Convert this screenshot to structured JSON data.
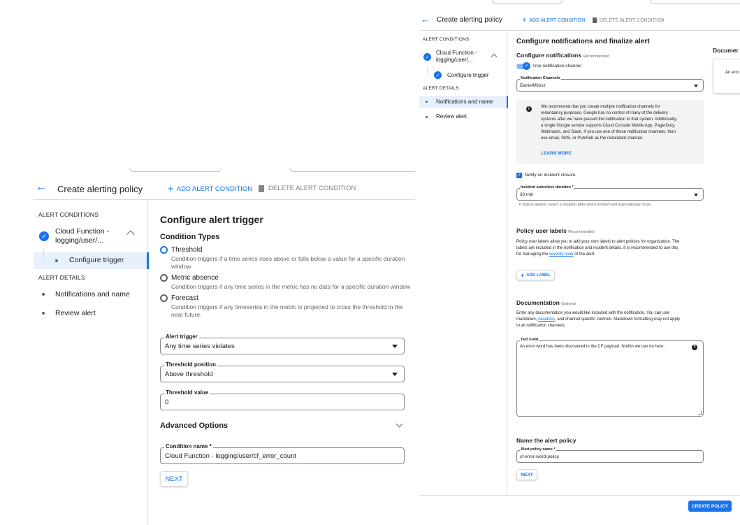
{
  "left": {
    "header": {
      "title": "Create alerting policy",
      "add_condition": "ADD ALERT CONDITION",
      "delete_condition": "DELETE ALERT CONDITION"
    },
    "sidebar": {
      "alert_conditions_label": "ALERT CONDITIONS",
      "condition_name_line1": "Cloud Function -",
      "condition_name_line2": "logging/user/...",
      "configure_trigger": "Configure trigger",
      "alert_details_label": "ALERT DETAILS",
      "notifications_and_name": "Notifications and name",
      "review_alert": "Review alert"
    },
    "main": {
      "title": "Configure alert trigger",
      "condition_types_heading": "Condition Types",
      "options": [
        {
          "label": "Threshold",
          "desc_line1": "Condition triggers if a time series rises above or falls below a value for a specific duration",
          "desc_line2": "window",
          "selected": true
        },
        {
          "label": "Metric absence",
          "desc_line1": "Condition triggers if any time series in the metric has no data for a specific duration window",
          "desc_line2": "",
          "selected": false
        },
        {
          "label": "Forecast",
          "desc_line1": "Condition triggers if any timeseries in the metric is projected to cross the threshold in the",
          "desc_line2": "near future.",
          "selected": false
        }
      ],
      "alert_trigger": {
        "label": "Alert trigger",
        "value": "Any time series violates"
      },
      "threshold_position": {
        "label": "Threshold position",
        "value": "Above threshold"
      },
      "threshold_value": {
        "label": "Threshold value",
        "value": "0"
      },
      "advanced_options": "Advanced Options",
      "condition_name": {
        "label": "Condition name *",
        "value": "Cloud Function - logging/user/cf_error_count"
      },
      "next": "NEXT"
    }
  },
  "right": {
    "header": {
      "title": "Create alerting policy",
      "add_condition": "ADD ALERT CONDITION",
      "delete_condition": "DELETE ALERT CONDITION"
    },
    "sidebar": {
      "alert_conditions_label": "ALERT CONDITIONS",
      "condition_name_line1": "Cloud Function -",
      "condition_name_line2": "logging/user/...",
      "configure_trigger": "Configure trigger",
      "alert_details_label": "ALERT DETAILS",
      "notifications_and_name": "Notifications and name",
      "review_alert": "Review alert"
    },
    "main": {
      "title": "Configure notifications and finalize alert",
      "configure_notifications": "Configure notifications",
      "recommended": "Recommended",
      "use_notification_channel": "Use notification channel",
      "notification_channels": {
        "label": "Notification Channels",
        "value": "DanielMilosz"
      },
      "info_lines": [
        "We recommend that you create multiple notification channels for",
        "redundancy purposes. Google has no control of many of the delivery",
        "systems after we have passed the notification to that system. Additionally,",
        "a single Google service supports Cloud Console Mobile App, PagerDuty,",
        "Webhooks, and Slack. If you use one of these notification channels, then",
        "use email, SMS, or Pub/Sub as the redundant channel."
      ],
      "learn_more": "LEARN MORE",
      "notify_on_closure": "Notify on incident closure",
      "autoclose": {
        "label": "Incident autoclose duration *",
        "value": "30 min"
      },
      "autoclose_hint": "If data is absent, select a duration after which incident will automatically close.",
      "labels_heading": "Policy user labels",
      "labels_recommended": "Recommended",
      "labels_desc_line1": "Policy user labels allow you to add your own labels to alert policies for organization. The",
      "labels_desc_line2": "labels are included in the notification and incident details. It is recommended to use this",
      "labels_desc_line3_pre": "for managing the",
      "labels_desc_link": "severity level",
      "labels_desc_line3_post": "of the alert.",
      "add_label": "ADD LABEL",
      "doc_heading": "Documentation",
      "doc_optional": "Optional",
      "doc_desc_line1": "Enter any documentation you would like included with the notification. You can use",
      "doc_desc_line2_pre": "markdown,",
      "doc_desc_link": "variables",
      "doc_desc_line2_post": ", and channel-specific controls. Markdown formatting may not apply",
      "doc_desc_line3": "to all notification channels.",
      "text_field": {
        "label": "Text Field",
        "value": "An error word has been discovered in the CF payload. Nothin we can do here."
      },
      "name_heading": "Name the alert policy",
      "policy_name": {
        "label": "Alert policy name *",
        "value": "cf-error-word-policy"
      },
      "next": "NEXT",
      "create_policy": "CREATE POLICY"
    },
    "doc_preview": {
      "heading": "Documer",
      "snippet": "An erro"
    }
  }
}
